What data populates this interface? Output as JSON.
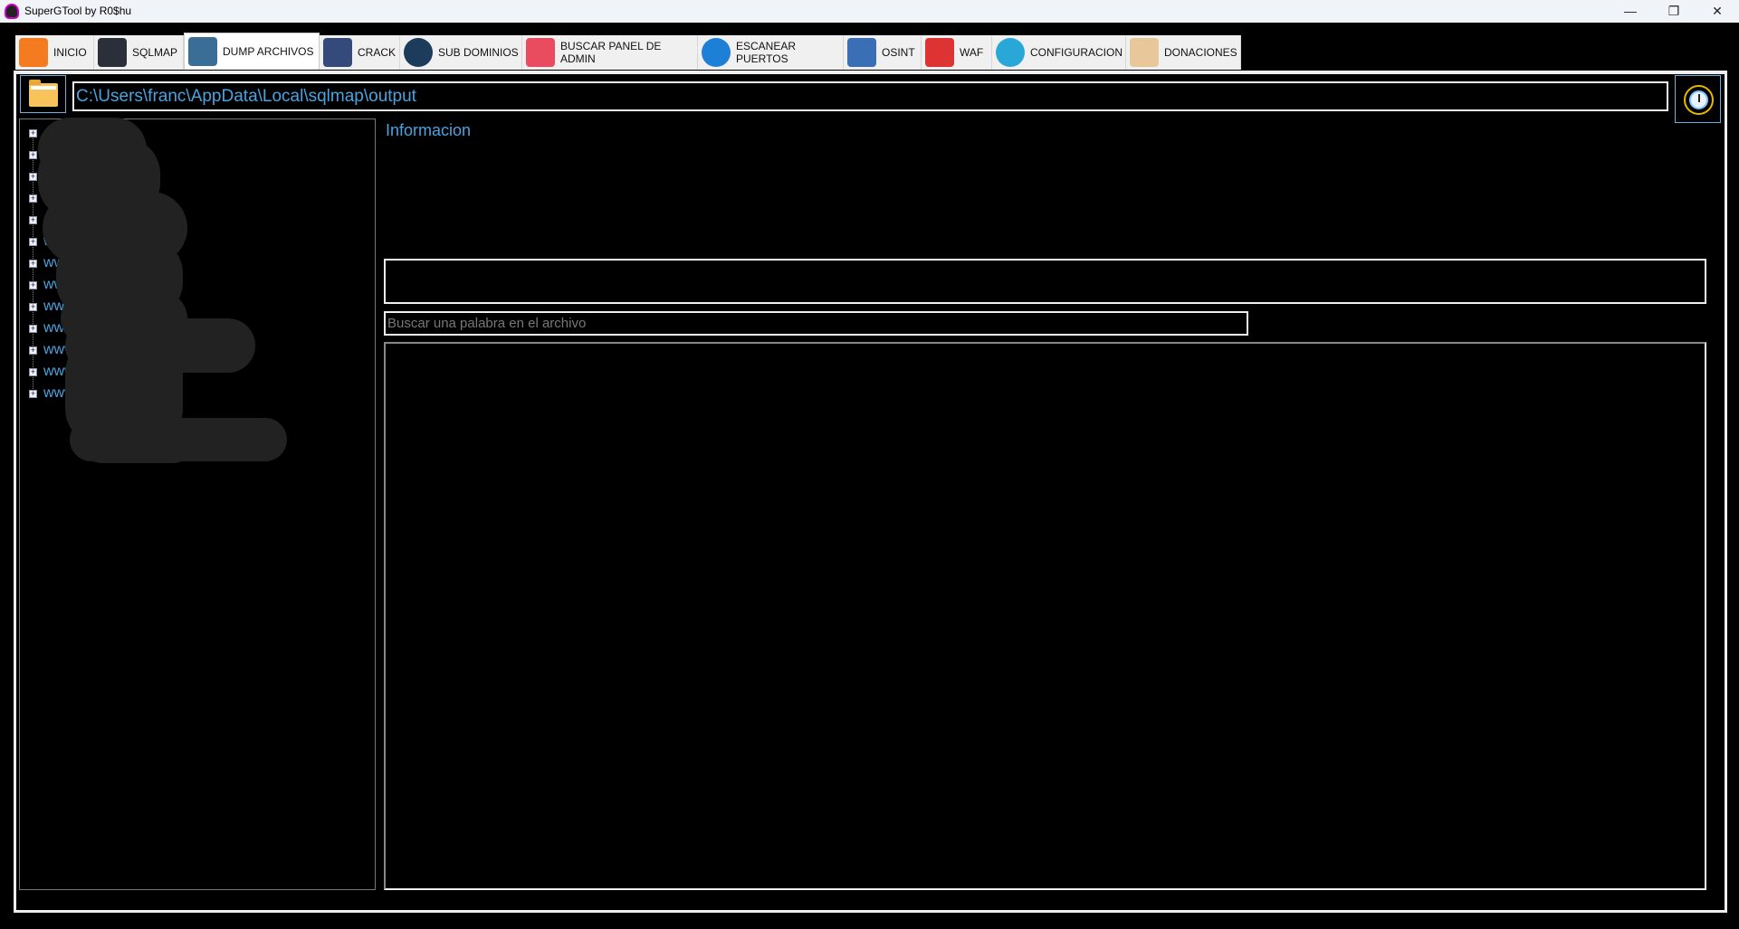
{
  "window": {
    "title": "SuperGTool by R0$hu",
    "minimize": "—",
    "maximize": "❐",
    "close": "✕"
  },
  "tabs": [
    {
      "label": "INICIO",
      "icon": "home-icon"
    },
    {
      "label": "SQLMAP",
      "icon": "terminal-icon"
    },
    {
      "label": "DUMP ARCHIVOS",
      "icon": "database-download-icon",
      "selected": true
    },
    {
      "label": "CRACK",
      "icon": "password-lock-icon"
    },
    {
      "label": "SUB DOMINIOS",
      "icon": "globe-network-icon"
    },
    {
      "label": "BUSCAR PANEL DE ADMIN",
      "icon": "admin-panel-icon"
    },
    {
      "label": "ESCANEAR PUERTOS",
      "icon": "globe-port-icon"
    },
    {
      "label": "OSINT",
      "icon": "unlock-data-icon"
    },
    {
      "label": "WAF",
      "icon": "firewall-icon"
    },
    {
      "label": "CONFIGURACION",
      "icon": "gear-icon"
    },
    {
      "label": "DONACIONES",
      "icon": "donate-box-icon"
    }
  ],
  "path_input": {
    "value": "C:\\Users\\franc\\AppData\\Local\\sqlmap\\output"
  },
  "tree": {
    "items": [
      "",
      "",
      "",
      "",
      "",
      "ww",
      "www",
      "www",
      "www",
      "ww",
      "www",
      "www",
      "www"
    ]
  },
  "info": {
    "label": "Informacion"
  },
  "search": {
    "placeholder": "Buscar una palabra en el archivo"
  },
  "colors": {
    "accent": "#4aa3df",
    "background": "#000000",
    "border": "#eeeeee"
  }
}
